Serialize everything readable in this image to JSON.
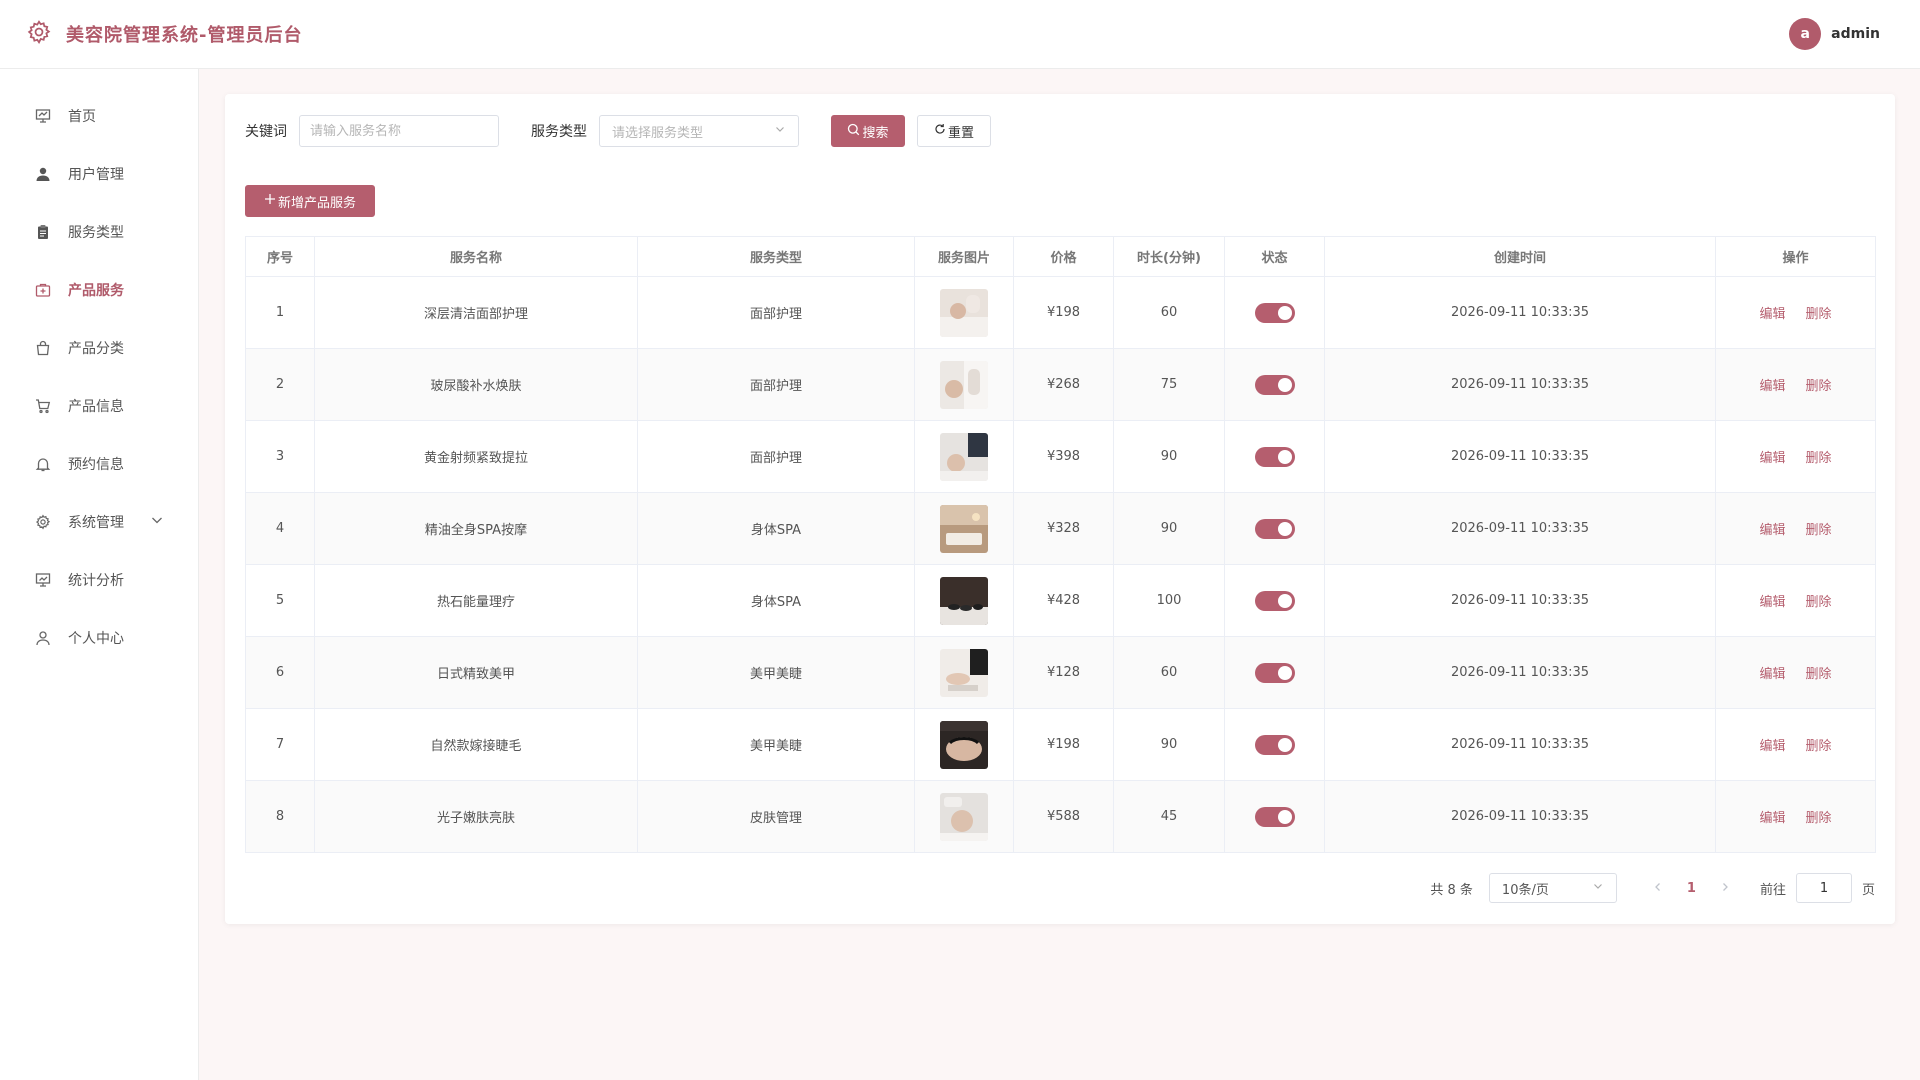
{
  "header": {
    "title": "美容院管理系统-管理员后台",
    "avatar_letter": "a",
    "username": "admin",
    "accent": "#b55e6e"
  },
  "sidebar": {
    "items": [
      {
        "label": "首页",
        "icon": "home-icon"
      },
      {
        "label": "用户管理",
        "icon": "user-icon"
      },
      {
        "label": "服务类型",
        "icon": "clipboard-icon"
      },
      {
        "label": "产品服务",
        "icon": "medical-box-icon",
        "active": true
      },
      {
        "label": "产品分类",
        "icon": "bag-icon"
      },
      {
        "label": "产品信息",
        "icon": "cart-icon"
      },
      {
        "label": "预约信息",
        "icon": "bell-icon"
      },
      {
        "label": "系统管理",
        "icon": "gear-icon",
        "has_children": true
      },
      {
        "label": "统计分析",
        "icon": "chart-icon"
      },
      {
        "label": "个人中心",
        "icon": "person-icon"
      }
    ]
  },
  "filters": {
    "keyword_label": "关键词",
    "keyword_placeholder": "请输入服务名称",
    "keyword_value": "",
    "type_label": "服务类型",
    "type_placeholder": "请选择服务类型",
    "search_label": "搜索",
    "reset_label": "重置"
  },
  "toolbar": {
    "add_label": "新增产品服务"
  },
  "table": {
    "columns": [
      "序号",
      "服务名称",
      "服务类型",
      "服务图片",
      "价格",
      "时长(分钟)",
      "状态",
      "创建时间",
      "操作"
    ],
    "edit_label": "编辑",
    "delete_label": "删除",
    "rows": [
      {
        "index": "1",
        "name": "深层清洁面部护理",
        "type": "面部护理",
        "price": "¥198",
        "duration": "60",
        "enabled": true,
        "created": "2026-09-11 10:33:35"
      },
      {
        "index": "2",
        "name": "玻尿酸补水焕肤",
        "type": "面部护理",
        "price": "¥268",
        "duration": "75",
        "enabled": true,
        "created": "2026-09-11 10:33:35"
      },
      {
        "index": "3",
        "name": "黄金射频紧致提拉",
        "type": "面部护理",
        "price": "¥398",
        "duration": "90",
        "enabled": true,
        "created": "2026-09-11 10:33:35"
      },
      {
        "index": "4",
        "name": "精油全身SPA按摩",
        "type": "身体SPA",
        "price": "¥328",
        "duration": "90",
        "enabled": true,
        "created": "2026-09-11 10:33:35"
      },
      {
        "index": "5",
        "name": "热石能量理疗",
        "type": "身体SPA",
        "price": "¥428",
        "duration": "100",
        "enabled": true,
        "created": "2026-09-11 10:33:35"
      },
      {
        "index": "6",
        "name": "日式精致美甲",
        "type": "美甲美睫",
        "price": "¥128",
        "duration": "60",
        "enabled": true,
        "created": "2026-09-11 10:33:35"
      },
      {
        "index": "7",
        "name": "自然款嫁接睫毛",
        "type": "美甲美睫",
        "price": "¥198",
        "duration": "90",
        "enabled": true,
        "created": "2026-09-11 10:33:35"
      },
      {
        "index": "8",
        "name": "光子嫩肤亮肤",
        "type": "皮肤管理",
        "price": "¥588",
        "duration": "45",
        "enabled": true,
        "created": "2026-09-11 10:33:35"
      }
    ]
  },
  "pagination": {
    "total_text": "共 8 条",
    "page_size": "10条/页",
    "current_page": "1",
    "goto_label": "前往",
    "goto_value": "1",
    "page_suffix": "页"
  }
}
